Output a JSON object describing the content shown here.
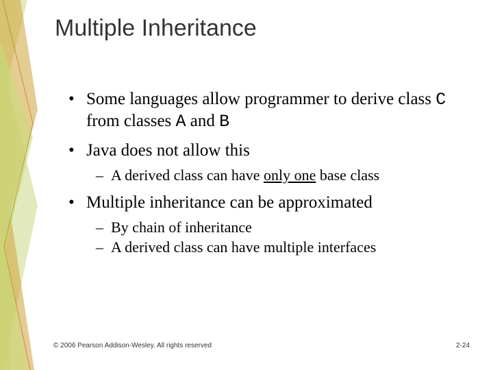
{
  "title": "Multiple Inheritance",
  "bullets": [
    {
      "pre": "Some languages allow programmer to derive class ",
      "c1": "C",
      "mid1": " from classes ",
      "c2": "A",
      "mid2": " and ",
      "c3": "B"
    },
    {
      "text": "Java does not allow this",
      "sub": [
        {
          "pre": "A derived class can have ",
          "u": "only one",
          "post": " base class"
        }
      ]
    },
    {
      "text": "Multiple inheritance can be approximated",
      "sub": [
        {
          "text": "By chain of inheritance"
        },
        {
          "text": "A derived class can have multiple interfaces"
        }
      ]
    }
  ],
  "footer": {
    "copyright": "© 2006 Pearson Addison-Wesley. All rights reserved",
    "page": "2-24"
  }
}
